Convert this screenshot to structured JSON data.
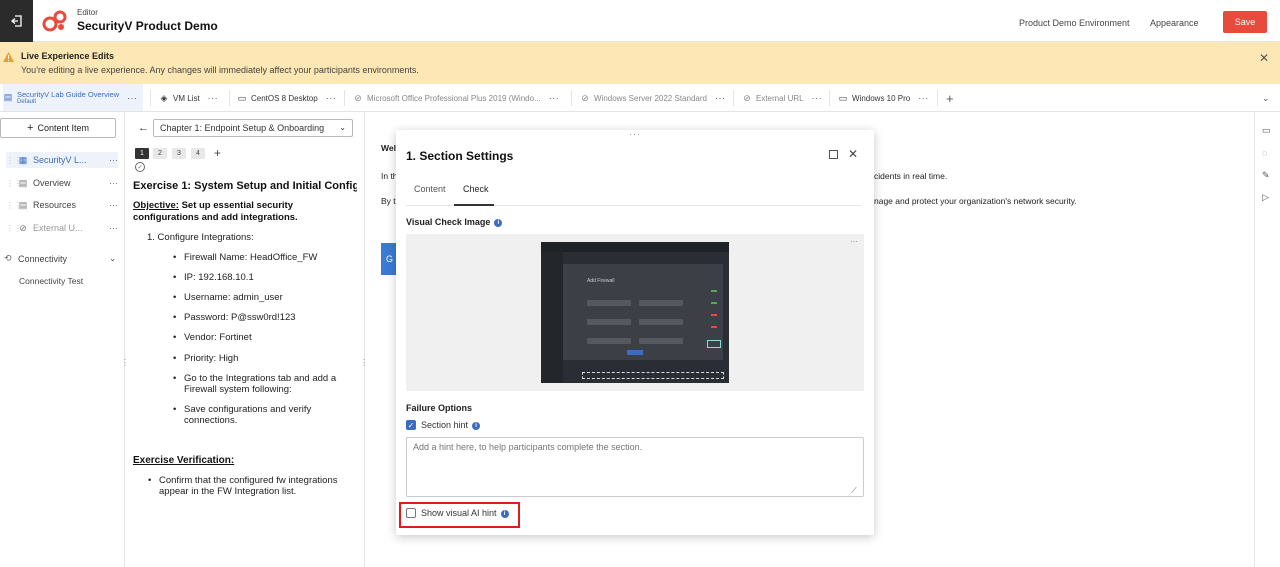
{
  "header": {
    "subtitle": "Editor",
    "title": "SecurityV Product Demo",
    "environment_link": "Product Demo Environment",
    "appearance_link": "Appearance",
    "save_label": "Save"
  },
  "banner": {
    "title": "Live Experience Edits",
    "text": "You're editing a live experience. Any changes will immediately affect your participants environments."
  },
  "tabs": [
    {
      "label": "SecurityV Lab Guide Overview",
      "sub": "Default",
      "icon": "document-icon"
    },
    {
      "label": "VM List",
      "icon": "layers-icon"
    },
    {
      "label": "CentOS 8 Desktop",
      "icon": "monitor-icon"
    },
    {
      "label": "Microsoft Office Professional Plus 2019 (Windo...",
      "icon": "eye-off-icon"
    },
    {
      "label": "Windows Server 2022 Standard",
      "icon": "eye-off-icon"
    },
    {
      "label": "External URL",
      "icon": "eye-off-icon"
    },
    {
      "label": "Windows 10 Pro",
      "icon": "monitor-icon"
    }
  ],
  "sidebar": {
    "add_button": "Content Item",
    "items": [
      {
        "label": "SecurityV L...",
        "icon": "grid-icon"
      },
      {
        "label": "Overview",
        "icon": "list-icon"
      },
      {
        "label": "Resources",
        "icon": "list-icon"
      },
      {
        "label": "External U...",
        "icon": "eye-off-icon"
      }
    ],
    "connectivity": "Connectivity",
    "connectivity_test": "Connectivity Test"
  },
  "guide": {
    "chapter": "Chapter 1: Endpoint Setup & Onboarding",
    "pages": [
      "1",
      "2",
      "3",
      "4"
    ],
    "exercise_title": "Exercise 1: System Setup and Initial Config...",
    "objective_label": "Objective:",
    "objective_text": "Set up essential security configurations and add integrations.",
    "step": "1. Configure Integrations:",
    "bullets": [
      "Firewall Name: HeadOffice_FW",
      "IP: 192.168.10.1",
      "Username: admin_user",
      "Password: P@ssw0rd!123",
      "Vendor: Fortinet",
      "Priority: High",
      "Go to the Integrations tab and add a",
      "Firewall system following:",
      "Save configurations and verify",
      "connections."
    ],
    "verification_title": "Exercise Verification:",
    "verification_bullet_1": "Confirm that the configured fw integrations",
    "verification_bullet_2": "appear in the FW Integration list."
  },
  "right": {
    "welcome": "Wel",
    "line1_start": "In th",
    "line1_end": "cidents in real time.",
    "line2_start": "By t",
    "line2_end": "nage and protect your organization's network security.",
    "button_initial": "G"
  },
  "modal": {
    "title": "1. Section Settings",
    "tab_content": "Content",
    "tab_check": "Check",
    "visual_check_label": "Visual Check Image",
    "thumb_title": "Add Firewall",
    "failure_options": "Failure Options",
    "section_hint": "Section hint",
    "hint_placeholder": "Add a hint here, to help participants complete the section.",
    "visual_ai_hint": "Show visual AI hint"
  }
}
